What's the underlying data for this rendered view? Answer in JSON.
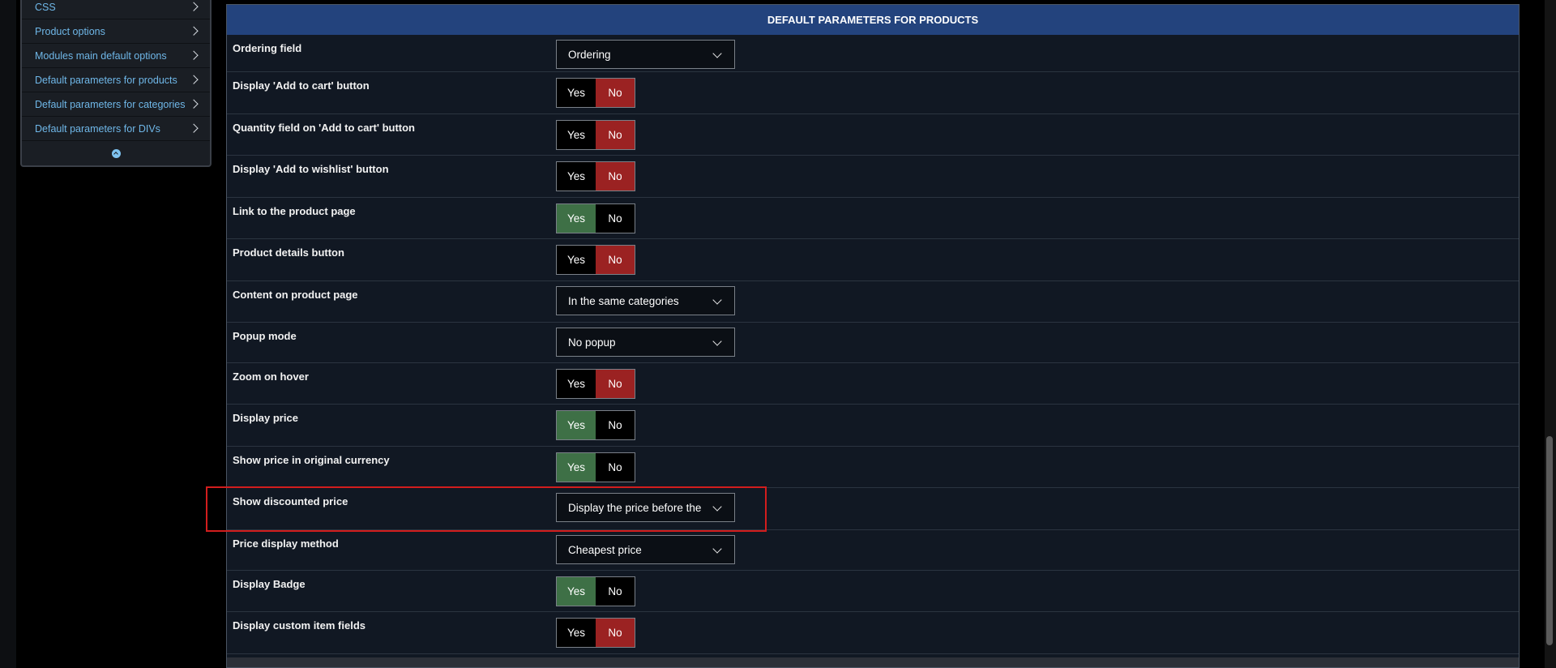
{
  "sidebar": {
    "items": [
      {
        "label": "CSS"
      },
      {
        "label": "Product options"
      },
      {
        "label": "Modules main default options"
      },
      {
        "label": "Default parameters for products"
      },
      {
        "label": "Default parameters for categories"
      },
      {
        "label": "Default parameters for DIVs"
      }
    ]
  },
  "panel": {
    "title": "DEFAULT PARAMETERS FOR PRODUCTS",
    "toggle_labels": {
      "yes": "Yes",
      "no": "No"
    },
    "rows": [
      {
        "label": "Ordering field",
        "type": "select",
        "value": "Ordering"
      },
      {
        "label": "Display 'Add to cart' button",
        "type": "toggle",
        "value": "No"
      },
      {
        "label": "Quantity field on 'Add to cart' button",
        "type": "toggle",
        "value": "No"
      },
      {
        "label": "Display 'Add to wishlist' button",
        "type": "toggle",
        "value": "No"
      },
      {
        "label": "Link to the product page",
        "type": "toggle",
        "value": "Yes"
      },
      {
        "label": "Product details button",
        "type": "toggle",
        "value": "No"
      },
      {
        "label": "Content on product page",
        "type": "select",
        "value": "In the same categories"
      },
      {
        "label": "Popup mode",
        "type": "select",
        "value": "No popup"
      },
      {
        "label": "Zoom on hover",
        "type": "toggle",
        "value": "No"
      },
      {
        "label": "Display price",
        "type": "toggle",
        "value": "Yes"
      },
      {
        "label": "Show price in original currency",
        "type": "toggle",
        "value": "Yes"
      },
      {
        "label": "Show discounted price",
        "type": "select",
        "value": "Display the price before the"
      },
      {
        "label": "Price display method",
        "type": "select",
        "value": "Cheapest price"
      },
      {
        "label": "Display Badge",
        "type": "toggle",
        "value": "Yes"
      },
      {
        "label": "Display custom item fields",
        "type": "toggle",
        "value": "No"
      }
    ]
  },
  "colors": {
    "header": "#23437d",
    "yes_active": "#3e7046",
    "no_active": "#9b2222",
    "highlight": "#d21d1d",
    "sidebar_link": "#6fb7e8"
  }
}
